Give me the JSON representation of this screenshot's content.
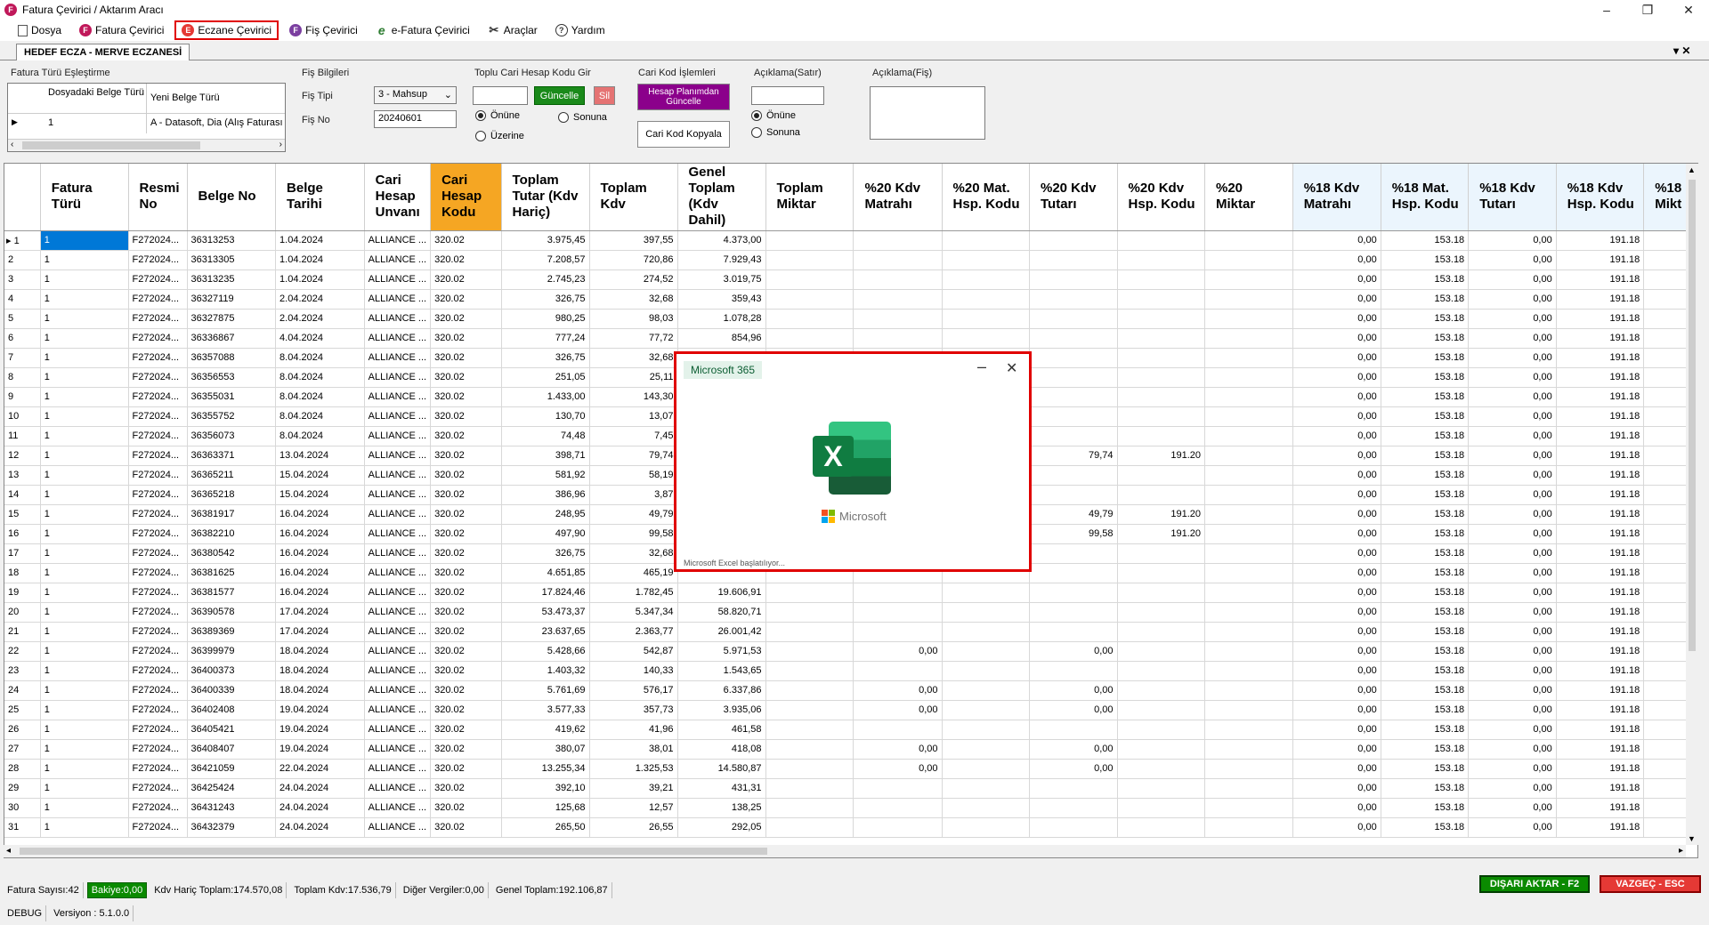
{
  "window": {
    "title": "Fatura Çevirici / Aktarım Aracı"
  },
  "menu": [
    {
      "label": "Dosya",
      "icon": "document-icon",
      "color": "#555555"
    },
    {
      "label": "Fatura Çevirici",
      "icon": "f-badge-icon",
      "color": "#c0185a"
    },
    {
      "label": "Eczane Çevirici",
      "icon": "e-badge-icon",
      "color": "#e53935",
      "active": true
    },
    {
      "label": "Fiş Çevirici",
      "icon": "f-badge-icon",
      "color": "#7b3fa0"
    },
    {
      "label": "e-Fatura Çevirici",
      "icon": "e-script-icon",
      "color": "#2e7d32"
    },
    {
      "label": "Araçlar",
      "icon": "tools-icon",
      "color": "#333333"
    },
    {
      "label": "Yardım",
      "icon": "help-icon",
      "color": "#333333"
    }
  ],
  "tab": {
    "label": "HEDEF ECZA - MERVE ECZANESİ"
  },
  "fatura_turu": {
    "title": "Fatura Türü Eşleştirme",
    "col1": "Dosyadaki Belge Türü",
    "col2": "Yeni Belge Türü",
    "row_val1": "1",
    "row_val2": "A - Datasoft, Dia (Alış Faturası"
  },
  "fis_bilgileri": {
    "title": "Fiş Bilgileri",
    "fis_tipi_label": "Fiş Tipi",
    "fis_tipi_value": "3 - Mahsup",
    "fis_no_label": "Fiş No",
    "fis_no_value": "20240601"
  },
  "toplu_cari": {
    "title": "Toplu Cari Hesap Kodu Gir",
    "guncelle": "Güncelle",
    "sil": "Sil",
    "onune": "Önüne",
    "sonuna": "Sonuna",
    "uzerine": "Üzerine"
  },
  "cari_kod": {
    "title": "Cari Kod İşlemleri",
    "hesap_btn": "Hesap Planımdan Güncelle",
    "kopyala_btn": "Cari Kod Kopyala"
  },
  "aciklama_satir": {
    "title": "Açıklama(Satır)",
    "onune": "Önüne",
    "sonuna": "Sonuna"
  },
  "aciklama_fis": {
    "title": "Açıklama(Fiş)"
  },
  "grid": {
    "headers": [
      "Fatura Türü",
      "Resmi No",
      "Belge No",
      "Belge Tarihi",
      "Cari Hesap Unvanı",
      "Cari Hesap Kodu",
      "Toplam Tutar (Kdv Hariç)",
      "Toplam Kdv",
      "Genel Toplam (Kdv Dahil)",
      "Toplam Miktar",
      "%20 Kdv Matrahı",
      "%20 Mat. Hsp. Kodu",
      "%20 Kdv Tutarı",
      "%20 Kdv Hsp. Kodu",
      "%20 Miktar",
      "%18 Kdv Matrahı",
      "%18 Mat. Hsp. Kodu",
      "%18 Kdv Tutarı",
      "%18 Kdv Hsp. Kodu",
      "%18 Mikt"
    ],
    "rows": [
      [
        "1",
        "1",
        "F272024...",
        "36313253",
        "1.04.2024",
        "ALLIANCE ...",
        "320.02",
        "3.975,45",
        "397,55",
        "4.373,00",
        "",
        "",
        "",
        "",
        "",
        "",
        "0,00",
        "153.18",
        "0,00",
        "191.18"
      ],
      [
        "2",
        "1",
        "F272024...",
        "36313305",
        "1.04.2024",
        "ALLIANCE ...",
        "320.02",
        "7.208,57",
        "720,86",
        "7.929,43",
        "",
        "",
        "",
        "",
        "",
        "",
        "0,00",
        "153.18",
        "0,00",
        "191.18"
      ],
      [
        "3",
        "1",
        "F272024...",
        "36313235",
        "1.04.2024",
        "ALLIANCE ...",
        "320.02",
        "2.745,23",
        "274,52",
        "3.019,75",
        "",
        "",
        "",
        "",
        "",
        "",
        "0,00",
        "153.18",
        "0,00",
        "191.18"
      ],
      [
        "4",
        "1",
        "F272024...",
        "36327119",
        "2.04.2024",
        "ALLIANCE ...",
        "320.02",
        "326,75",
        "32,68",
        "359,43",
        "",
        "",
        "",
        "",
        "",
        "",
        "0,00",
        "153.18",
        "0,00",
        "191.18"
      ],
      [
        "5",
        "1",
        "F272024...",
        "36327875",
        "2.04.2024",
        "ALLIANCE ...",
        "320.02",
        "980,25",
        "98,03",
        "1.078,28",
        "",
        "",
        "",
        "",
        "",
        "",
        "0,00",
        "153.18",
        "0,00",
        "191.18"
      ],
      [
        "6",
        "1",
        "F272024...",
        "36336867",
        "4.04.2024",
        "ALLIANCE ...",
        "320.02",
        "777,24",
        "77,72",
        "854,96",
        "",
        "",
        "",
        "",
        "",
        "",
        "0,00",
        "153.18",
        "0,00",
        "191.18"
      ],
      [
        "7",
        "1",
        "F272024...",
        "36357088",
        "8.04.2024",
        "ALLIANCE ...",
        "320.02",
        "326,75",
        "32,68",
        "",
        "",
        "",
        "",
        "",
        "",
        "",
        "0,00",
        "153.18",
        "0,00",
        "191.18"
      ],
      [
        "8",
        "1",
        "F272024...",
        "36356553",
        "8.04.2024",
        "ALLIANCE ...",
        "320.02",
        "251,05",
        "25,11",
        "",
        "",
        "",
        "",
        "",
        "",
        "",
        "0,00",
        "153.18",
        "0,00",
        "191.18"
      ],
      [
        "9",
        "1",
        "F272024...",
        "36355031",
        "8.04.2024",
        "ALLIANCE ...",
        "320.02",
        "1.433,00",
        "143,30",
        "",
        "",
        "",
        "",
        "",
        "",
        "",
        "0,00",
        "153.18",
        "0,00",
        "191.18"
      ],
      [
        "10",
        "1",
        "F272024...",
        "36355752",
        "8.04.2024",
        "ALLIANCE ...",
        "320.02",
        "130,70",
        "13,07",
        "",
        "",
        "",
        "",
        "",
        "",
        "",
        "0,00",
        "153.18",
        "0,00",
        "191.18"
      ],
      [
        "11",
        "1",
        "F272024...",
        "36356073",
        "8.04.2024",
        "ALLIANCE ...",
        "320.02",
        "74,48",
        "7,45",
        "",
        "",
        "",
        "",
        "",
        "",
        "",
        "0,00",
        "153.18",
        "0,00",
        "191.18"
      ],
      [
        "12",
        "1",
        "F272024...",
        "36363371",
        "13.04.2024",
        "ALLIANCE ...",
        "320.02",
        "398,71",
        "79,74",
        "",
        "",
        "",
        "",
        "79,74",
        "191.20",
        "",
        "0,00",
        "153.18",
        "0,00",
        "191.18"
      ],
      [
        "13",
        "1",
        "F272024...",
        "36365211",
        "15.04.2024",
        "ALLIANCE ...",
        "320.02",
        "581,92",
        "58,19",
        "",
        "",
        "",
        "",
        "",
        "",
        "",
        "0,00",
        "153.18",
        "0,00",
        "191.18"
      ],
      [
        "14",
        "1",
        "F272024...",
        "36365218",
        "15.04.2024",
        "ALLIANCE ...",
        "320.02",
        "386,96",
        "3,87",
        "",
        "",
        "",
        "",
        "",
        "",
        "",
        "0,00",
        "153.18",
        "0,00",
        "191.18"
      ],
      [
        "15",
        "1",
        "F272024...",
        "36381917",
        "16.04.2024",
        "ALLIANCE ...",
        "320.02",
        "248,95",
        "49,79",
        "",
        "",
        "",
        "",
        "49,79",
        "191.20",
        "",
        "0,00",
        "153.18",
        "0,00",
        "191.18"
      ],
      [
        "16",
        "1",
        "F272024...",
        "36382210",
        "16.04.2024",
        "ALLIANCE ...",
        "320.02",
        "497,90",
        "99,58",
        "",
        "",
        "",
        "",
        "99,58",
        "191.20",
        "",
        "0,00",
        "153.18",
        "0,00",
        "191.18"
      ],
      [
        "17",
        "1",
        "F272024...",
        "36380542",
        "16.04.2024",
        "ALLIANCE ...",
        "320.02",
        "326,75",
        "32,68",
        "",
        "",
        "",
        "",
        "",
        "",
        "",
        "0,00",
        "153.18",
        "0,00",
        "191.18"
      ],
      [
        "18",
        "1",
        "F272024...",
        "36381625",
        "16.04.2024",
        "ALLIANCE ...",
        "320.02",
        "4.651,85",
        "465,19",
        "",
        "",
        "",
        "",
        "",
        "",
        "",
        "0,00",
        "153.18",
        "0,00",
        "191.18"
      ],
      [
        "19",
        "1",
        "F272024...",
        "36381577",
        "16.04.2024",
        "ALLIANCE ...",
        "320.02",
        "17.824,46",
        "1.782,45",
        "19.606,91",
        "",
        "",
        "",
        "",
        "",
        "",
        "0,00",
        "153.18",
        "0,00",
        "191.18"
      ],
      [
        "20",
        "1",
        "F272024...",
        "36390578",
        "17.04.2024",
        "ALLIANCE ...",
        "320.02",
        "53.473,37",
        "5.347,34",
        "58.820,71",
        "",
        "",
        "",
        "",
        "",
        "",
        "0,00",
        "153.18",
        "0,00",
        "191.18"
      ],
      [
        "21",
        "1",
        "F272024...",
        "36389369",
        "17.04.2024",
        "ALLIANCE ...",
        "320.02",
        "23.637,65",
        "2.363,77",
        "26.001,42",
        "",
        "",
        "",
        "",
        "",
        "",
        "0,00",
        "153.18",
        "0,00",
        "191.18"
      ],
      [
        "22",
        "1",
        "F272024...",
        "36399979",
        "18.04.2024",
        "ALLIANCE ...",
        "320.02",
        "5.428,66",
        "542,87",
        "5.971,53",
        "",
        "0,00",
        "",
        "0,00",
        "",
        "",
        "0,00",
        "153.18",
        "0,00",
        "191.18"
      ],
      [
        "23",
        "1",
        "F272024...",
        "36400373",
        "18.04.2024",
        "ALLIANCE ...",
        "320.02",
        "1.403,32",
        "140,33",
        "1.543,65",
        "",
        "",
        "",
        "",
        "",
        "",
        "0,00",
        "153.18",
        "0,00",
        "191.18"
      ],
      [
        "24",
        "1",
        "F272024...",
        "36400339",
        "18.04.2024",
        "ALLIANCE ...",
        "320.02",
        "5.761,69",
        "576,17",
        "6.337,86",
        "",
        "0,00",
        "",
        "0,00",
        "",
        "",
        "0,00",
        "153.18",
        "0,00",
        "191.18"
      ],
      [
        "25",
        "1",
        "F272024...",
        "36402408",
        "19.04.2024",
        "ALLIANCE ...",
        "320.02",
        "3.577,33",
        "357,73",
        "3.935,06",
        "",
        "0,00",
        "",
        "0,00",
        "",
        "",
        "0,00",
        "153.18",
        "0,00",
        "191.18"
      ],
      [
        "26",
        "1",
        "F272024...",
        "36405421",
        "19.04.2024",
        "ALLIANCE ...",
        "320.02",
        "419,62",
        "41,96",
        "461,58",
        "",
        "",
        "",
        "",
        "",
        "",
        "0,00",
        "153.18",
        "0,00",
        "191.18"
      ],
      [
        "27",
        "1",
        "F272024...",
        "36408407",
        "19.04.2024",
        "ALLIANCE ...",
        "320.02",
        "380,07",
        "38,01",
        "418,08",
        "",
        "0,00",
        "",
        "0,00",
        "",
        "",
        "0,00",
        "153.18",
        "0,00",
        "191.18"
      ],
      [
        "28",
        "1",
        "F272024...",
        "36421059",
        "22.04.2024",
        "ALLIANCE ...",
        "320.02",
        "13.255,34",
        "1.325,53",
        "14.580,87",
        "",
        "0,00",
        "",
        "0,00",
        "",
        "",
        "0,00",
        "153.18",
        "0,00",
        "191.18"
      ],
      [
        "29",
        "1",
        "F272024...",
        "36425424",
        "24.04.2024",
        "ALLIANCE ...",
        "320.02",
        "392,10",
        "39,21",
        "431,31",
        "",
        "",
        "",
        "",
        "",
        "",
        "0,00",
        "153.18",
        "0,00",
        "191.18"
      ],
      [
        "30",
        "1",
        "F272024...",
        "36431243",
        "24.04.2024",
        "ALLIANCE ...",
        "320.02",
        "125,68",
        "12,57",
        "138,25",
        "",
        "",
        "",
        "",
        "",
        "",
        "0,00",
        "153.18",
        "0,00",
        "191.18"
      ],
      [
        "31",
        "1",
        "F272024...",
        "36432379",
        "24.04.2024",
        "ALLIANCE ...",
        "320.02",
        "265,50",
        "26,55",
        "292,05",
        "",
        "",
        "",
        "",
        "",
        "",
        "0,00",
        "153.18",
        "0,00",
        "191.18"
      ]
    ]
  },
  "status": {
    "fatura_sayisi": "Fatura Sayısı:42",
    "bakiye": "Bakiye:0,00",
    "kdv_haric": "Kdv Hariç Toplam:174.570,08",
    "toplam_kdv": "Toplam Kdv:17.536,79",
    "diger": "Diğer Vergiler:0,00",
    "genel": "Genel Toplam:192.106,87"
  },
  "actions": {
    "export": "DIŞARI AKTAR - F2",
    "cancel": "VAZGEÇ - ESC"
  },
  "footer": {
    "mode": "DEBUG",
    "version": "Versiyon : 5.1.0.0"
  },
  "dialog": {
    "badge": "Microsoft 365",
    "brand": "Microsoft",
    "app_letter": "X",
    "status": "Microsoft Excel başlatılıyor..."
  },
  "colors": {
    "accent_header": "#f5a623",
    "selection": "#0078d7",
    "excel_green": "#107c41",
    "highlight_border": "#e00000"
  }
}
